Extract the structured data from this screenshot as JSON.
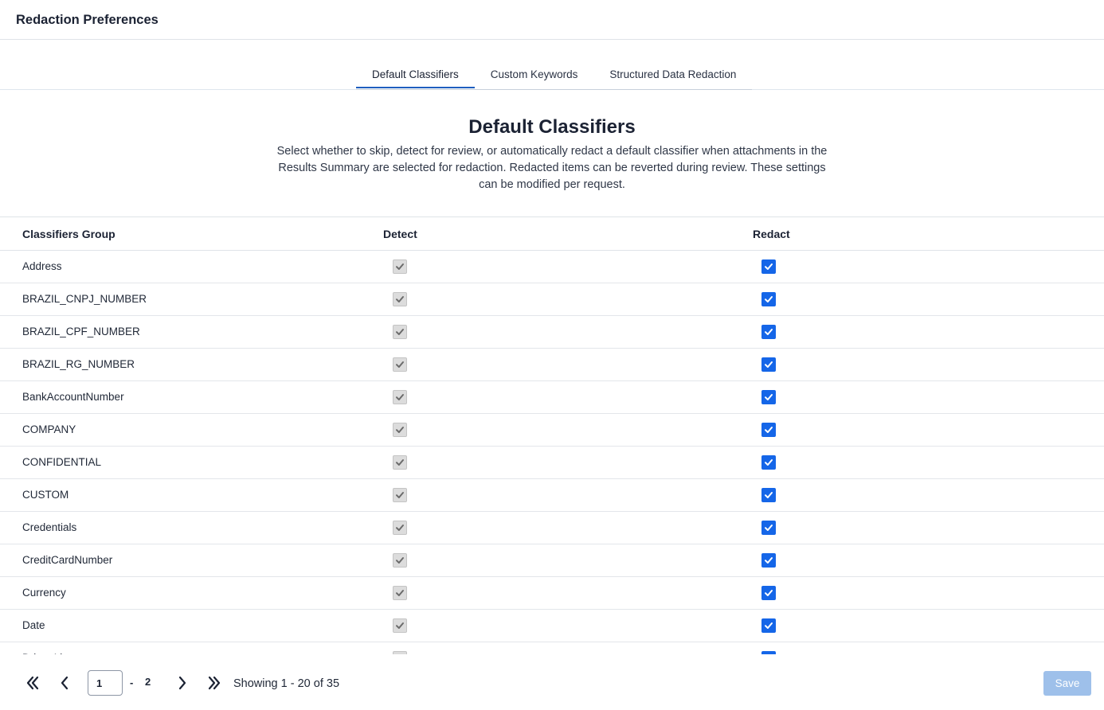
{
  "header": {
    "title": "Redaction Preferences"
  },
  "tabs": [
    {
      "label": "Default Classifiers",
      "active": true
    },
    {
      "label": "Custom Keywords",
      "active": false
    },
    {
      "label": "Structured Data Redaction",
      "active": false
    }
  ],
  "section": {
    "title": "Default Classifiers",
    "description": "Select whether to skip, detect for review, or automatically redact a default classifier when attachments in the Results Summary are selected for redaction. Redacted items can be reverted during review. These settings can be modified per request."
  },
  "table": {
    "headers": {
      "group": "Classifiers Group",
      "detect": "Detect",
      "redact": "Redact"
    },
    "rows": [
      {
        "name": "Address",
        "detect": true,
        "redact": true
      },
      {
        "name": "BRAZIL_CNPJ_NUMBER",
        "detect": true,
        "redact": true
      },
      {
        "name": "BRAZIL_CPF_NUMBER",
        "detect": true,
        "redact": true
      },
      {
        "name": "BRAZIL_RG_NUMBER",
        "detect": true,
        "redact": true
      },
      {
        "name": "BankAccountNumber",
        "detect": true,
        "redact": true
      },
      {
        "name": "COMPANY",
        "detect": true,
        "redact": true
      },
      {
        "name": "CONFIDENTIAL",
        "detect": true,
        "redact": true
      },
      {
        "name": "CUSTOM",
        "detect": true,
        "redact": true
      },
      {
        "name": "Credentials",
        "detect": true,
        "redact": true
      },
      {
        "name": "CreditCardNumber",
        "detect": true,
        "redact": true
      },
      {
        "name": "Currency",
        "detect": true,
        "redact": true
      },
      {
        "name": "Date",
        "detect": true,
        "redact": true
      },
      {
        "name": "Driver License",
        "detect": true,
        "redact": true
      }
    ]
  },
  "pagination": {
    "current_page": "1",
    "separator": "-",
    "total_pages": "2",
    "showing": "Showing 1 - 20 of 35"
  },
  "actions": {
    "save_label": "Save"
  },
  "colors": {
    "accent": "#1566e8",
    "tab_underline": "#1f5fbf",
    "save_disabled": "#9ec0ea",
    "detect_disabled": "#dcdcdc"
  },
  "icons": {
    "check": "check-icon",
    "first": "double-chevron-left-icon",
    "prev": "chevron-left-icon",
    "next": "chevron-right-icon",
    "last": "double-chevron-right-icon"
  }
}
